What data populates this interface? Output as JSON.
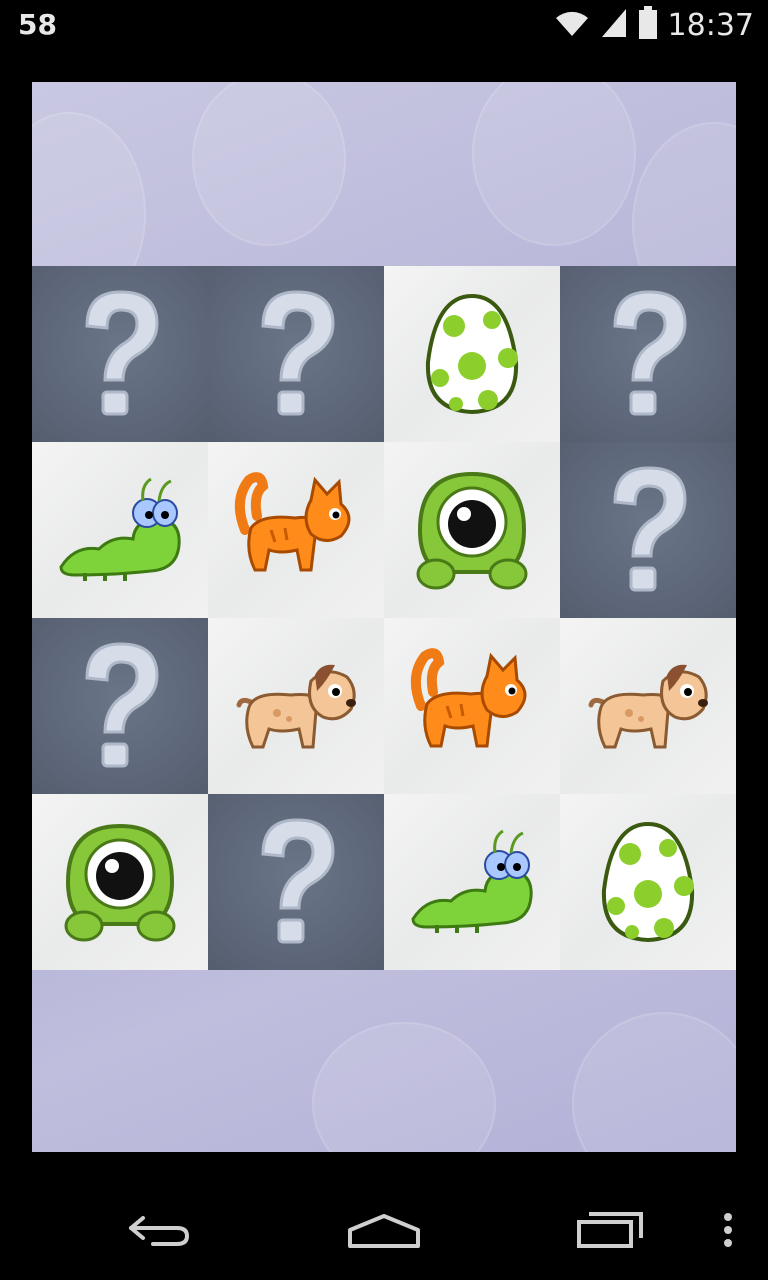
{
  "status_bar": {
    "notification_count": "58",
    "time": "18:37",
    "icons": [
      "wifi-icon",
      "signal-icon",
      "battery-icon"
    ]
  },
  "board": {
    "rows": 4,
    "columns": 4,
    "tiles": [
      {
        "state": "hidden",
        "icon": "question-mark-icon"
      },
      {
        "state": "hidden",
        "icon": "question-mark-icon"
      },
      {
        "state": "revealed",
        "icon": "egg-icon"
      },
      {
        "state": "hidden",
        "icon": "question-mark-icon"
      },
      {
        "state": "revealed",
        "icon": "caterpillar-icon"
      },
      {
        "state": "revealed",
        "icon": "cat-icon"
      },
      {
        "state": "revealed",
        "icon": "eye-monster-icon"
      },
      {
        "state": "hidden",
        "icon": "question-mark-icon"
      },
      {
        "state": "hidden",
        "icon": "question-mark-icon"
      },
      {
        "state": "revealed",
        "icon": "dog-icon"
      },
      {
        "state": "revealed",
        "icon": "cat-icon"
      },
      {
        "state": "revealed",
        "icon": "dog-icon"
      },
      {
        "state": "revealed",
        "icon": "eye-monster-icon"
      },
      {
        "state": "hidden",
        "icon": "question-mark-icon"
      },
      {
        "state": "revealed",
        "icon": "caterpillar-icon"
      },
      {
        "state": "revealed",
        "icon": "egg-icon"
      }
    ]
  },
  "nav_bar": {
    "buttons": [
      "back-icon",
      "home-icon",
      "recent-apps-icon",
      "overflow-menu-icon"
    ]
  },
  "colors": {
    "hidden_tile": "#5b6577",
    "revealed_tile": "#eeeeee",
    "board_background": "#b7b6d8"
  }
}
